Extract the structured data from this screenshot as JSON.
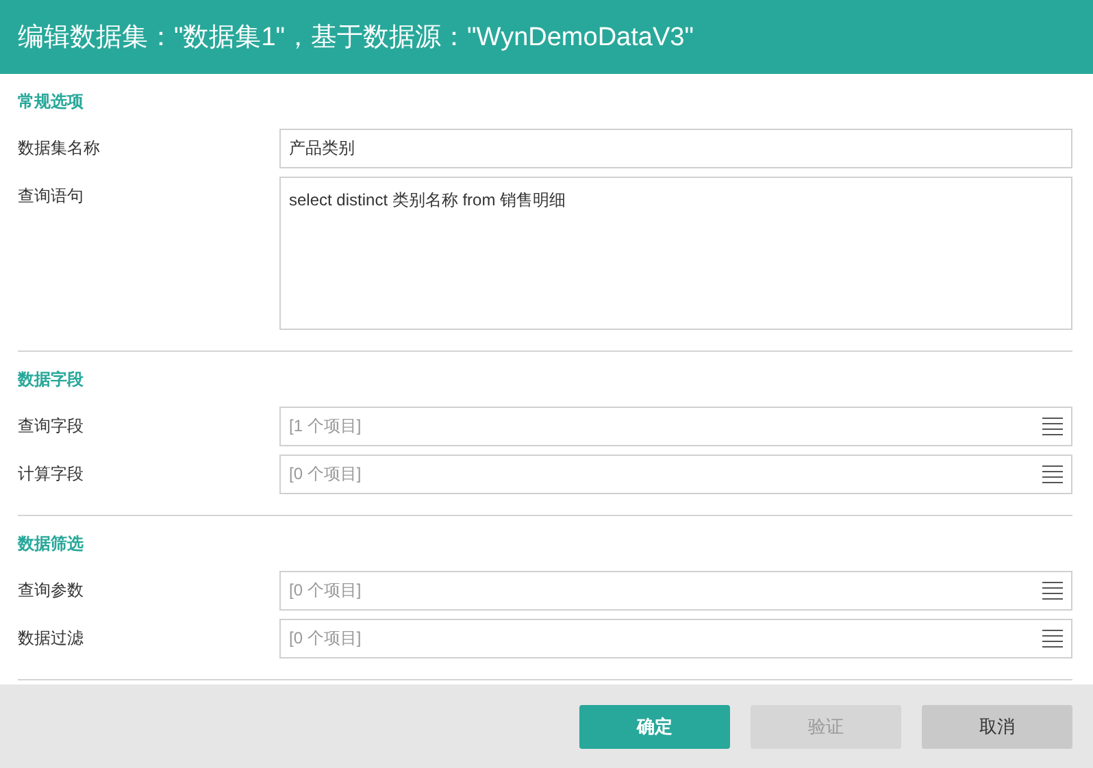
{
  "window": {
    "title": "编辑数据集：\"数据集1\"，基于数据源：\"WynDemoDataV3\""
  },
  "sections": [
    {
      "heading": "常规选项",
      "fields": [
        {
          "label": "数据集名称",
          "kind": "text",
          "value": "产品类别"
        },
        {
          "label": "查询语句",
          "kind": "textarea",
          "value": "select distinct 类别名称 from 销售明细"
        }
      ]
    },
    {
      "heading": "数据字段",
      "fields": [
        {
          "label": "查询字段",
          "kind": "collection",
          "value": "[1 个项目]"
        },
        {
          "label": "计算字段",
          "kind": "collection",
          "value": "[0 个项目]"
        }
      ]
    },
    {
      "heading": "数据筛选",
      "fields": [
        {
          "label": "查询参数",
          "kind": "collection",
          "value": "[0 个项目]"
        },
        {
          "label": "数据过滤",
          "kind": "collection",
          "value": "[0 个项目]"
        }
      ]
    }
  ],
  "buttons": [
    {
      "label": "确定",
      "kind": "primary",
      "disabled": false
    },
    {
      "label": "验证",
      "kind": "secondary",
      "disabled": true
    },
    {
      "label": "取消",
      "kind": "secondary",
      "disabled": false
    }
  ]
}
